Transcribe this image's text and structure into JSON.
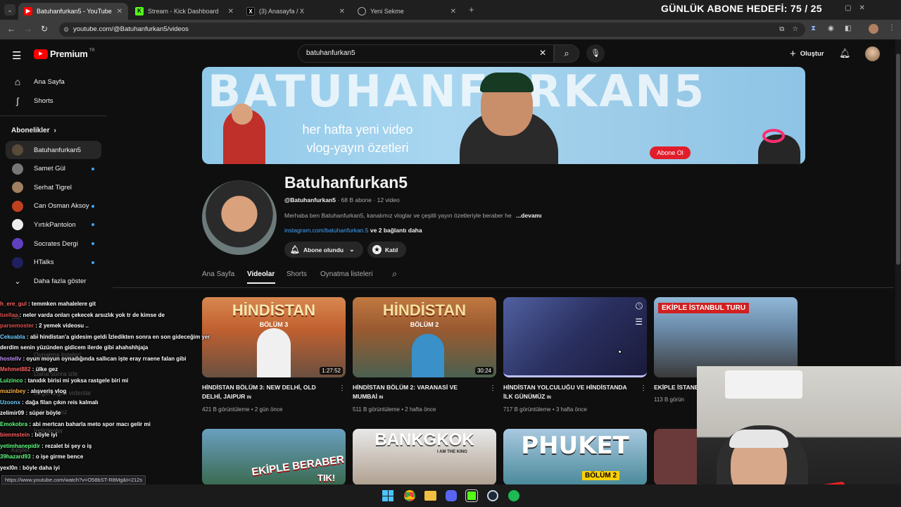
{
  "browser": {
    "tabs": [
      {
        "label": "Batuhanfurkan5 - YouTube",
        "color": "#ff0000"
      },
      {
        "label": "Stream - Kick Dashboard",
        "color": "#53fc18"
      },
      {
        "label": "(3) Anasayfa / X",
        "color": "#000000"
      },
      {
        "label": "Yeni Sekme",
        "color": "#888888"
      }
    ],
    "url": "youtube.com/@Batuhanfurkan5/videos",
    "overlay_title": "GÜNLÜK ABONE HEDEFİ: 75 / 25"
  },
  "header": {
    "logo": "Premium",
    "logo_sup": "TR",
    "search_value": "batuhanfurkan5",
    "create_label": "Oluştur"
  },
  "sidebar": {
    "home": "Ana Sayfa",
    "shorts": "Shorts",
    "subs_header": "Abonelikler",
    "subs": [
      {
        "name": "Batuhanfurkan5",
        "dot": false,
        "color": "#5a4a3a"
      },
      {
        "name": "Samet Gül",
        "dot": true,
        "color": "#777777"
      },
      {
        "name": "Serhat Tigrel",
        "dot": false,
        "color": "#a08060"
      },
      {
        "name": "Can Osman Aksoy",
        "dot": true,
        "color": "#c04020"
      },
      {
        "name": "YırtıkPantolon",
        "dot": true,
        "color": "#eeeeee"
      },
      {
        "name": "Socrates Dergi",
        "dot": true,
        "color": "#6040c0"
      },
      {
        "name": "HTalks",
        "dot": true,
        "color": "#202060"
      }
    ],
    "more": "Daha fazla göster"
  },
  "banner": {
    "big_text": "BATUHANFURKAN5",
    "line1": "her hafta yeni video",
    "line2": "vlog-yayın özetleri",
    "subscribe": "Abone Ol"
  },
  "channel": {
    "name": "Batuhanfurkan5",
    "handle": "@Batuhanfurkan5",
    "stats": " · 68 B abone · 12 video",
    "desc": "Merhaba ben Batuhanfurkan5,  kanalımız vloglar ve çeşitli yayın özetleriyle beraber he",
    "more": "...devamı",
    "link": "instagram.com/batuhanfurkan.5",
    "link_more": " ve 2 bağlantı daha",
    "subscribed": "Abone olundu",
    "join": "Katıl"
  },
  "tabs": [
    "Ana Sayfa",
    "Videolar",
    "Shorts",
    "Oynatma listeleri"
  ],
  "videos": [
    {
      "thumb": "HİNDİSTAN",
      "sub": "BÖLÜM 3",
      "duration": "1:27:52",
      "title": "HİNDİSTAN BÖLÜM 3: NEW DELHİ, OLD DELHİ, JAIPUR",
      "flag": "IN",
      "views": "421 B görüntüleme",
      "ago": "2 gün önce"
    },
    {
      "thumb": "HİNDİSTAN",
      "sub": "BÖLÜM 2",
      "duration": "30:24",
      "title": "HİNDİSTAN BÖLÜM 2: VARANASİ VE MUMBAİ",
      "flag": "IN",
      "views": "511 B görüntüleme",
      "ago": "2 hafta önce"
    },
    {
      "thumb": "",
      "sub": "",
      "duration": "",
      "title": "HİNDİSTAN YOLCULUĞU VE HİNDİSTANDA İLK GÜNÜMÜZ",
      "flag": "IN",
      "views": "717 B görüntüleme",
      "ago": "3 hafta önce"
    },
    {
      "thumb": "EKİPLE İSTANBUL TURU",
      "sub": "",
      "duration": "",
      "title": "EKİPLE İSTANB",
      "flag": "",
      "views": "113 B görün",
      "ago": ""
    }
  ],
  "videos_row2": [
    {
      "thumb": "EKİPLE BERABER",
      "sub": "TIK!"
    },
    {
      "thumb": "BANKGKOK",
      "sub": "I AM THE KING"
    },
    {
      "thumb": "PHUKET",
      "sub": "BÖLÜM 2"
    },
    {
      "thumb": "",
      "sub": ""
    }
  ],
  "chat": [
    {
      "user": "h_ere_gul",
      "msg": " : temmken mahalelere git",
      "color": "#ff6060"
    },
    {
      "user": "tuellaa",
      "msg": " : neler varda onları çekecek arsızlık yok tr de kimse de",
      "color": "#e05050"
    },
    {
      "user": "parsemoster",
      "msg": " : 2 yemek videosu ..",
      "color": "#e05050"
    },
    {
      "user": "Cekuabla",
      "msg": " : abi hindistan'a gidesim geldi İzledikten sonra en son gideceğim yer",
      "color": "#6fd0ff"
    },
    {
      "user": "",
      "msg": "derdim senin yüzünden gidicem ilerde gibi ahahshhjaja",
      "color": "#ffffff"
    },
    {
      "user": "hostellv",
      "msg": " : oyun moyun oynadığında sallıcan işte eray rraene falan gibi",
      "color": "#c090ff"
    },
    {
      "user": "Mehmet882",
      "msg": " : ülke gez",
      "color": "#ff6060"
    },
    {
      "user": "Luizinco",
      "msg": " : tanıdık birisi mi yoksa rastgele biri mi",
      "color": "#60ff80"
    },
    {
      "user": "mazinbey",
      "msg": " : alışveriş vlog",
      "color": "#ffb040"
    },
    {
      "user": "Uzoonx",
      "msg": " : dağa filan çıkın reis kalmalı",
      "color": "#6fd0ff"
    },
    {
      "user": "zelimir09",
      "msg": " : süper böyle",
      "color": "#ffffff"
    },
    {
      "user": "Emokobra",
      "msg": " : abi mertcan baharla meto spor macı gelir mi",
      "color": "#60ff80"
    },
    {
      "user": "bienmstein",
      "msg": " : böyle iyi",
      "color": "#ff6060"
    },
    {
      "user": "yetimhanepidir",
      "msg": " : rezalet bi şey o iş",
      "color": "#60ff80"
    },
    {
      "user": "39hazard93",
      "msg": " : o işe girme bence",
      "color": "#60ff80"
    },
    {
      "user": "yexl0n",
      "msg": " : böyle daha iyi",
      "color": "#ffffff"
    }
  ],
  "ghost_sidebar": [
    "Siz",
    "Geçmiş",
    "Oynatma listeleri",
    "Daha sonra izle",
    "Beğendiğim videolar",
    "Videolarınız",
    "İndirilenler",
    "Keşfet"
  ],
  "status_url": "https://www.youtube.com/watch?v=O58bST-R8Mg&t=212s"
}
